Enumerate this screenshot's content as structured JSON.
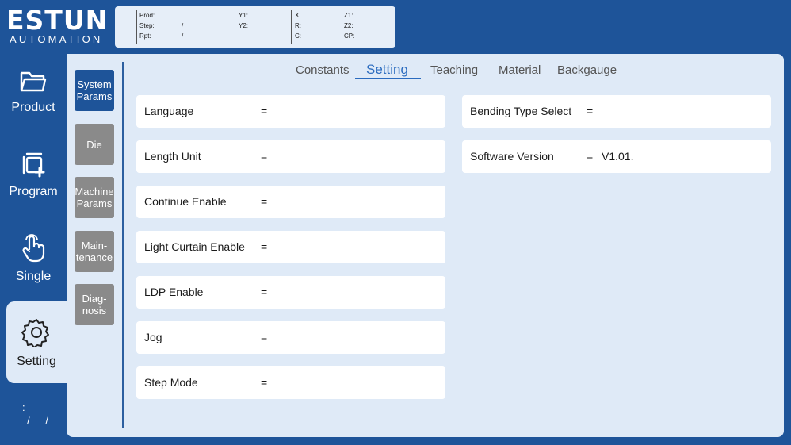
{
  "logo": {
    "main": "ESTUN",
    "sub": "AUTOMATION"
  },
  "status": {
    "prod_label": "Prod:",
    "step_label": "Step:",
    "rpt_label": "Rpt:",
    "step_value": "/",
    "rpt_value": "/",
    "y1_label": "Y1:",
    "y2_label": "Y2:",
    "x_label": "X:",
    "r_label": "R:",
    "c_label": "C:",
    "z1_label": "Z1:",
    "z2_label": "Z2:",
    "cp_label": "CP:"
  },
  "nav": {
    "items": [
      {
        "label": "Product",
        "icon": "folder-icon"
      },
      {
        "label": "Program",
        "icon": "copy-add-icon"
      },
      {
        "label": "Single",
        "icon": "hand-pointer-icon"
      },
      {
        "label": "Setting",
        "icon": "gear-icon"
      }
    ],
    "footer_line1": ":",
    "footer_line2": "/ /"
  },
  "subtabs": [
    {
      "label": "System Params"
    },
    {
      "label": "Die"
    },
    {
      "label": "Machine Params"
    },
    {
      "label": "Main-tenance"
    },
    {
      "label": "Diag-nosis"
    }
  ],
  "tabs": [
    {
      "label": "Constants"
    },
    {
      "label": "Setting"
    },
    {
      "label": "Teaching"
    },
    {
      "label": "Material"
    },
    {
      "label": "Backgauge"
    }
  ],
  "settings_left": [
    {
      "label": "Language",
      "eq": "=",
      "value": ""
    },
    {
      "label": "Length Unit",
      "eq": "=",
      "value": ""
    },
    {
      "label": "Continue Enable",
      "eq": "=",
      "value": ""
    },
    {
      "label": "Light Curtain Enable",
      "eq": "=",
      "value": ""
    },
    {
      "label": "LDP Enable",
      "eq": "=",
      "value": ""
    },
    {
      "label": "Jog",
      "eq": "=",
      "value": ""
    },
    {
      "label": "Step Mode",
      "eq": "=",
      "value": ""
    }
  ],
  "settings_right": [
    {
      "label": "Bending Type Select",
      "eq": "=",
      "value": ""
    },
    {
      "label": "Software Version",
      "eq": "=",
      "value": "V1.01."
    }
  ],
  "colors": {
    "background": "#1e5499",
    "panel": "#dfeaf7",
    "active_tab": "#2a6bbf",
    "inactive_subtab": "#8a8a8a"
  }
}
